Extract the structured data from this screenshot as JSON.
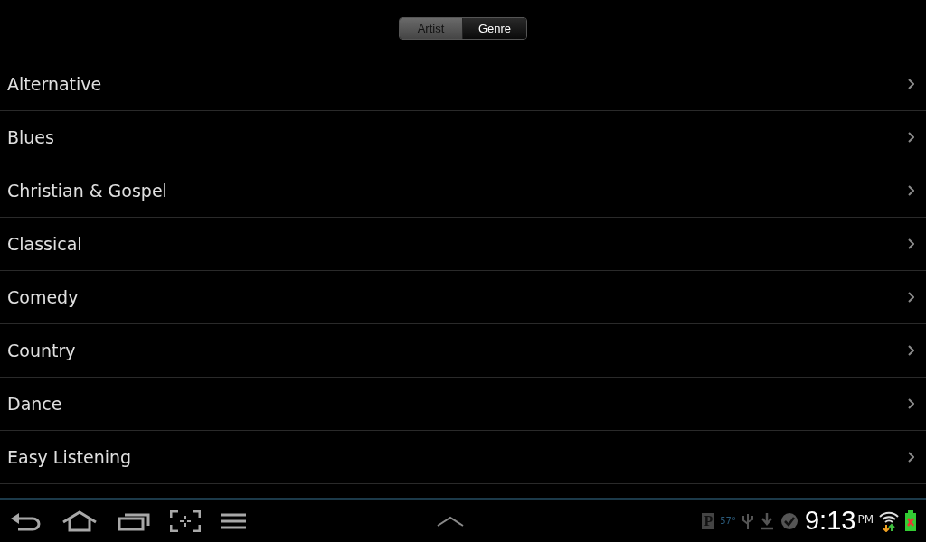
{
  "tabs": [
    {
      "label": "Artist",
      "selected": false
    },
    {
      "label": "Genre",
      "selected": true
    }
  ],
  "genres": [
    "Alternative",
    "Blues",
    "Christian & Gospel",
    "Classical",
    "Comedy",
    "Country",
    "Dance",
    "Easy Listening"
  ],
  "status_bar": {
    "app_letter": "P",
    "temperature": "57°",
    "time": "9:13",
    "ampm": "PM"
  }
}
